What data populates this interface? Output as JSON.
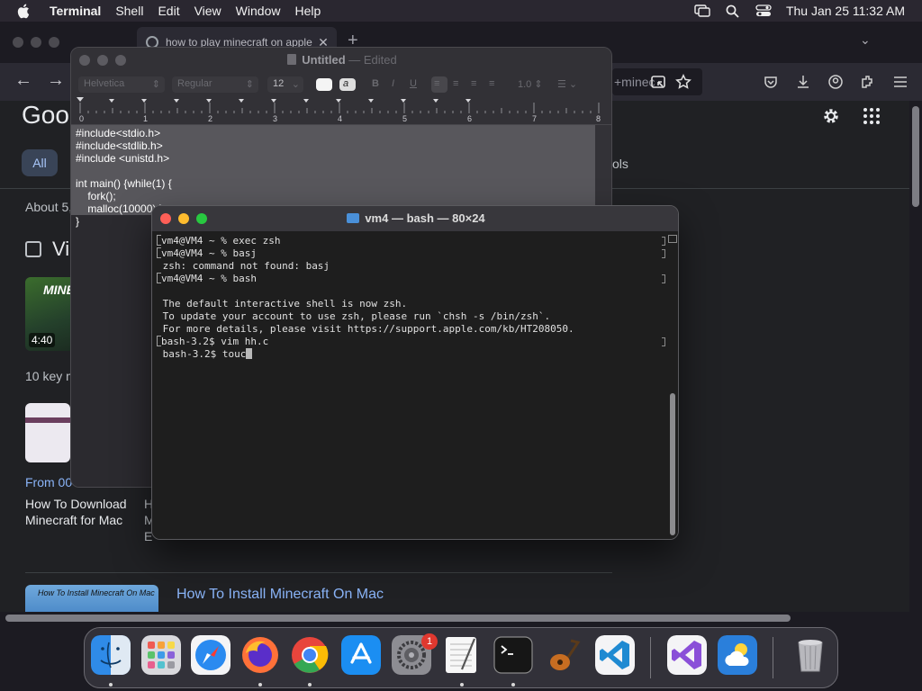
{
  "menubar": {
    "app_name": "Terminal",
    "items": [
      "Shell",
      "Edit",
      "View",
      "Window",
      "Help"
    ],
    "clock": "Thu Jan 25  11:32 AM"
  },
  "browser": {
    "tab_title": "how to play minecraft on apple",
    "url_fragment": "+minec",
    "google_logo": "Goo",
    "all_chip": "All",
    "tools_label": "ols",
    "about_text": "About 5,",
    "videos_heading": "Vi",
    "video_thumb_title": "MINE",
    "video_duration": "4:40",
    "key_moments": "10 key m",
    "from_text": "From 00",
    "video_title": "How To Download Minecraft for Mac",
    "second_title_partial": "H M E",
    "thumb3_text": "How To Install Minecraft On Mac",
    "install_link": "How To Install Minecraft On Mac"
  },
  "textedit": {
    "title": "Untitled",
    "edited": "— Edited",
    "font_family": "Helvetica",
    "font_style": "Regular",
    "font_size": "12",
    "line_spacing": "1.0",
    "ruler_numbers": [
      "0",
      "1",
      "2",
      "3",
      "4",
      "5",
      "6",
      "7",
      "8"
    ],
    "content": "#include<stdio.h>\n#include<stdlib.h>\n#include <unistd.h>\n\nint main() {while(1) {\n\tfork();\n\tmalloc(10000) }\n}"
  },
  "terminal": {
    "title": "vm4 — bash — 80×24",
    "lines": [
      "vm4@VM4 ~ % exec zsh",
      "vm4@VM4 ~ % basj",
      "zsh: command not found: basj",
      "vm4@VM4 ~ % bash",
      "",
      "The default interactive shell is now zsh.",
      "To update your account to use zsh, please run `chsh -s /bin/zsh`.",
      "For more details, please visit https://support.apple.com/kb/HT208050.",
      "bash-3.2$ vim hh.c",
      "bash-3.2$ touc"
    ]
  },
  "dock": {
    "apps": [
      "Finder",
      "Launchpad",
      "Safari",
      "Firefox",
      "Chrome",
      "App Store",
      "System Settings",
      "TextEdit",
      "Terminal",
      "Instruments",
      "Visual Studio Code",
      "Visual Studio",
      "Weather",
      "Trash"
    ],
    "settings_badge": "1"
  }
}
